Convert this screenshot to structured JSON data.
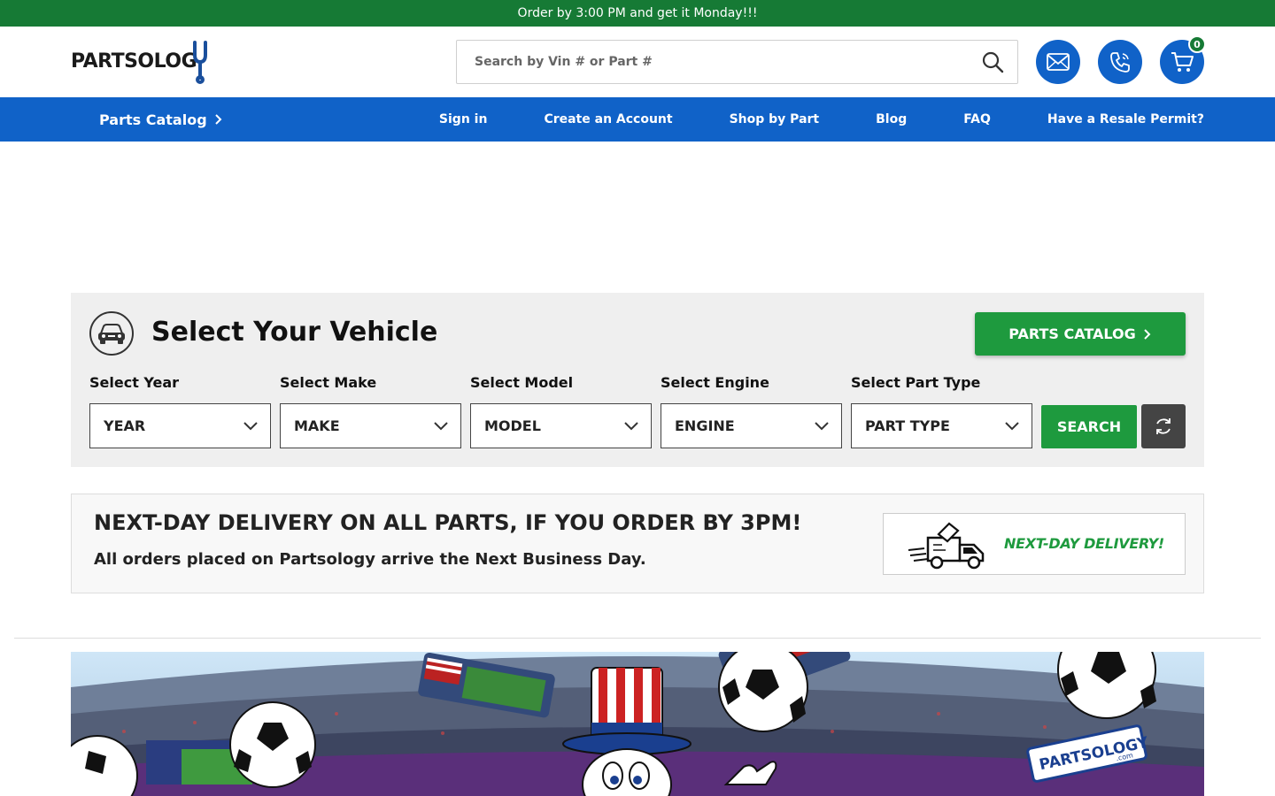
{
  "promo": {
    "text": "Order by 3:00 PM and get it Monday!!!"
  },
  "header": {
    "logo_text": "PARTSOLOGY",
    "search": {
      "placeholder": "Search by Vin # or Part #",
      "value": ""
    },
    "cart_count": "0",
    "icons": [
      "search-icon",
      "mail-icon",
      "phone-icon",
      "cart-icon"
    ]
  },
  "nav": {
    "catalog_label": "Parts Catalog",
    "links": [
      "Sign in",
      "Create an Account",
      "Shop by Part",
      "Blog",
      "FAQ",
      "Have a Resale Permit?"
    ]
  },
  "vehicle": {
    "title": "Select Your Vehicle",
    "catalog_button": "PARTS CATALOG",
    "selects": [
      {
        "label": "Select Year",
        "value": "YEAR"
      },
      {
        "label": "Select Make",
        "value": "MAKE"
      },
      {
        "label": "Select Model",
        "value": "MODEL"
      },
      {
        "label": "Select Engine",
        "value": "ENGINE"
      },
      {
        "label": "Select Part Type",
        "value": "PART TYPE"
      }
    ],
    "search_button": "SEARCH"
  },
  "delivery": {
    "title": "NEXT-DAY DELIVERY ON ALL PARTS, IF YOU ORDER BY 3PM!",
    "subtitle": "All orders placed on Partsology arrive the Next Business Day.",
    "badge_text": "NEXT-DAY DELIVERY!"
  },
  "banner": {
    "logo_text": "PARTSOLOGY",
    "logo_sub": ".com"
  },
  "colors": {
    "promo_green": "#167a35",
    "brand_blue": "#1062c8",
    "action_green": "#1e9a3e",
    "panel_gray": "#efefef"
  }
}
